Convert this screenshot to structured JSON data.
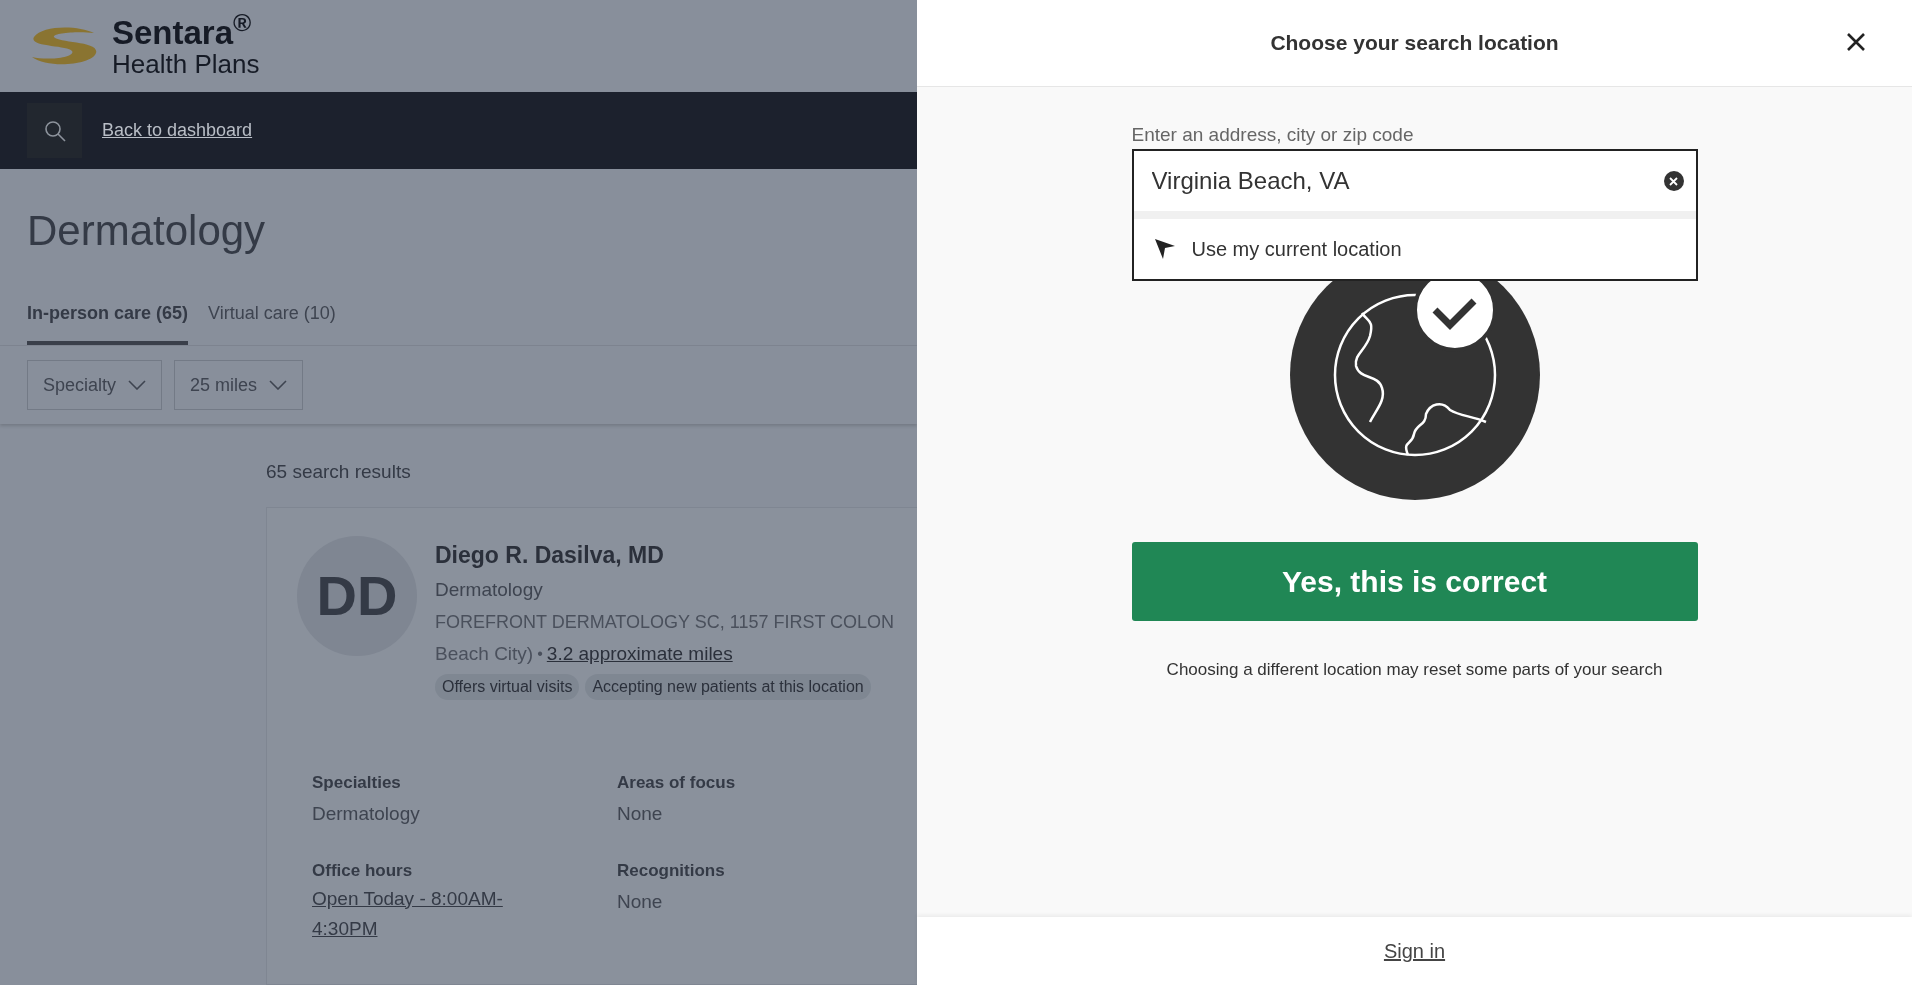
{
  "logo": {
    "brand": "Sentara$^{®}$",
    "subtitle": "Health Plans"
  },
  "nav": {
    "link": "Back to dashboard"
  },
  "page_title": "Dermatology",
  "tabs": [
    {
      "label": "In-person care (65)",
      "selected": true
    },
    {
      "label": "Virtual care (10)",
      "selected": false
    }
  ],
  "filters": [
    "Specialty",
    "25 miles"
  ],
  "results_count": "65 search results",
  "provider": {
    "initials": "DD",
    "name": "Diego R. Dasilva, MD",
    "specialty": "Dermatology",
    "address": "FOREFRONT DERMATOLOGY SC, 1157 FIRST COLON",
    "address_cont": "Beach City)",
    "separator": "•",
    "distance": "3.2 approximate miles",
    "tags": [
      "Offers virtual visits",
      "Accepting new patients at this location"
    ],
    "details": [
      {
        "label": "Specialties",
        "value": "Dermatology",
        "link": false
      },
      {
        "label": "Areas of focus",
        "value": "None",
        "link": false
      },
      {
        "label": "Office hours",
        "value": "Open Today - 8:00AM-4:30PM",
        "link": true
      },
      {
        "label": "Recognitions",
        "value": "None",
        "link": false
      }
    ]
  },
  "dialog": {
    "title": "Choose your search location",
    "field_label": "Enter an address, city or zip code",
    "field_value": "Virginia Beach, VA",
    "suggestion": "Use my current location",
    "confirm_button": "Yes, this is correct",
    "note": "Choosing a different location may reset some parts of your search",
    "footer_link": "Sign in"
  }
}
